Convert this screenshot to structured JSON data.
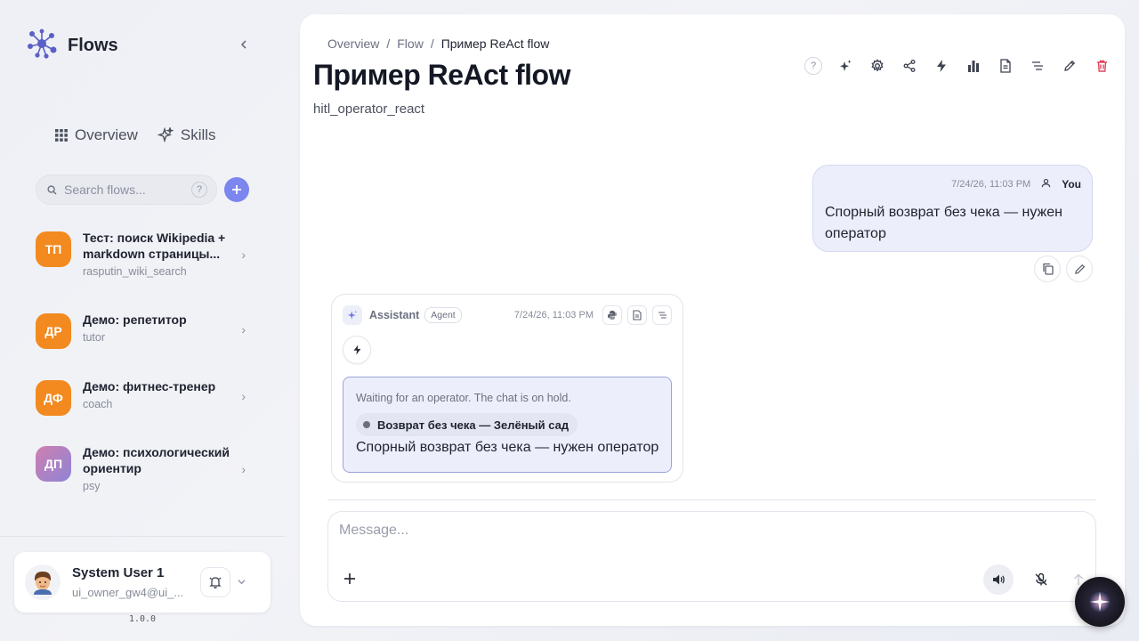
{
  "app": {
    "name": "Flows",
    "version": "1.0.0"
  },
  "nav": {
    "tabs": [
      {
        "label": "Overview",
        "icon": "grid-icon"
      },
      {
        "label": "Skills",
        "icon": "sparkles-icon"
      }
    ]
  },
  "search": {
    "placeholder": "Search flows...",
    "help": "?"
  },
  "flows": [
    {
      "initials": "ТП",
      "name": "Тест: поиск Wikipedia + markdown страницы...",
      "slug": "rasputin_wiki_search",
      "color": "#f28a1f"
    },
    {
      "initials": "ДР",
      "name": "Демо: репетитор",
      "slug": "tutor",
      "color": "#f28a1f"
    },
    {
      "initials": "ДФ",
      "name": "Демо: фитнес-тренер",
      "slug": "coach",
      "color": "#f28a1f"
    },
    {
      "initials": "ДП",
      "name": "Демо: психологический ориентир",
      "slug": "psy",
      "color": "#b07fc6"
    }
  ],
  "user": {
    "name": "System User 1",
    "email": "ui_owner_gw4@ui_..."
  },
  "breadcrumb": {
    "root": "Overview",
    "sep": "/",
    "middle": "Flow",
    "current": "Пример ReAct flow"
  },
  "page": {
    "title": "Пример ReAct flow",
    "subtitle": "hitl_operator_react"
  },
  "toolbar": {
    "help": "?",
    "icons": [
      "help-icon",
      "magic-icon",
      "settings-icon",
      "share-icon",
      "lightning-icon",
      "chart-icon",
      "document-icon",
      "list-icon",
      "edit-icon",
      "trash-icon"
    ]
  },
  "messages": {
    "user": {
      "time": "7/24/26, 11:03 PM",
      "author": "You",
      "text": "Спорный возврат без чека — нужен оператор"
    },
    "assistant": {
      "name": "Assistant",
      "badge": "Agent",
      "time": "7/24/26, 11:03 PM",
      "hitl": {
        "note": "Waiting for an operator. The chat is on hold.",
        "chip": "Возврат без чека — Зелёный сад",
        "text": "Спорный возврат без чека — нужен оператор"
      }
    }
  },
  "composer": {
    "placeholder": "Message..."
  },
  "colors": {
    "accent": "#7b86ee",
    "danger": "#e0435a",
    "userBubble": "#edeefb"
  }
}
